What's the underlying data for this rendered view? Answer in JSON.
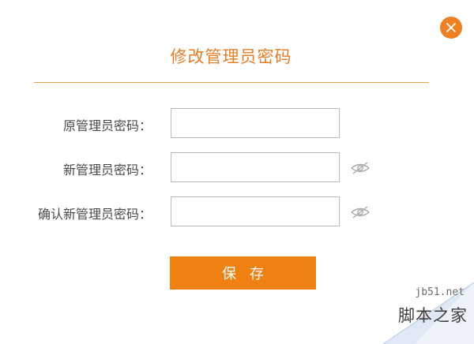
{
  "dialog": {
    "title": "修改管理员密码",
    "accent_color": "#ee7f22",
    "close_icon": "close-icon"
  },
  "form": {
    "fields": [
      {
        "label": "原管理员密码：",
        "value": "",
        "show_toggle": false
      },
      {
        "label": "新管理员密码：",
        "value": "",
        "show_toggle": true,
        "toggle_icon": "eye-slash-icon"
      },
      {
        "label": "确认新管理员密码：",
        "value": "",
        "show_toggle": true,
        "toggle_icon": "eye-slash-icon"
      }
    ],
    "save_label": "保 存"
  },
  "watermark": {
    "site": "jb51.net",
    "name": "脚本之家"
  }
}
